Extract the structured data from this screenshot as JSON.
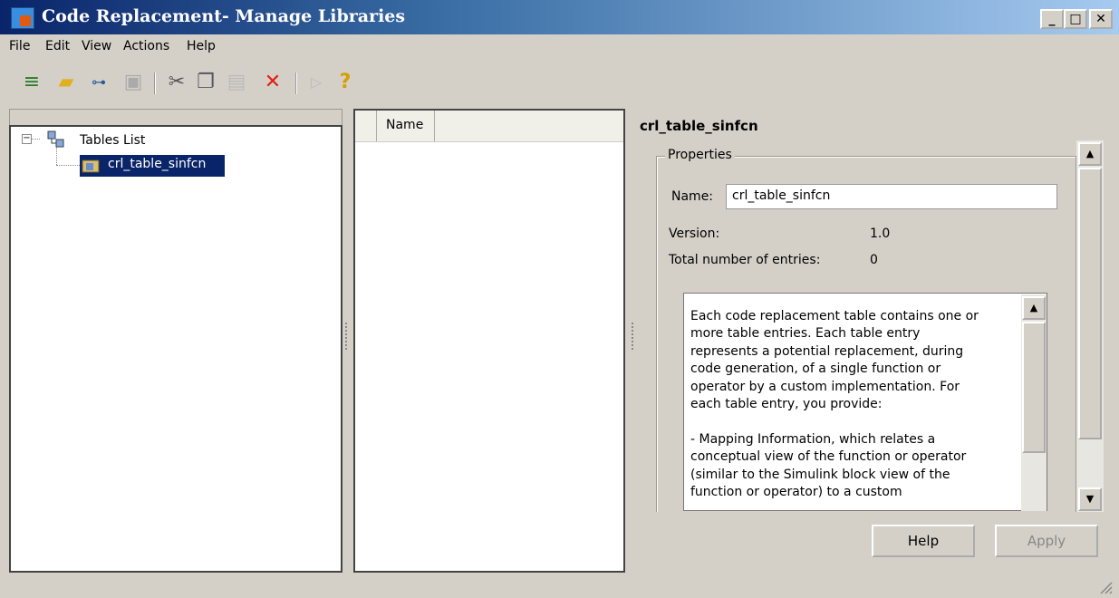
{
  "window": {
    "title": "Code Replacement- Manage Libraries",
    "minimize": "_",
    "maximize": "□",
    "close": "✕"
  },
  "menu": [
    "File",
    "Edit",
    "View",
    "Actions",
    "Help"
  ],
  "toolbar": {
    "icons": [
      "new-table-icon",
      "open-folder-icon",
      "add-entry-icon",
      "save-icon",
      "cut-icon",
      "copy-icon",
      "paste-icon",
      "delete-icon",
      "validate-icon",
      "help-icon"
    ]
  },
  "tree": {
    "root": "Tables List",
    "child": "crl_table_sinfcn"
  },
  "list": {
    "column": "Name"
  },
  "detail": {
    "title": "crl_table_sinfcn",
    "group_label": "Properties",
    "name_label": "Name:",
    "name_value": "crl_table_sinfcn",
    "version_label": "Version:",
    "version_value": "1.0",
    "entries_label": "Total number of entries:",
    "entries_value": "0",
    "description": "Each code replacement table contains one or\nmore table entries. Each table entry\nrepresents a potential replacement, during\ncode generation, of a single function or\noperator by a custom implementation. For\neach table entry, you provide:\n\n- Mapping Information, which relates a\nconceptual view of the function or operator\n(similar to the Simulink block view of the\nfunction or operator) to a custom"
  },
  "buttons": {
    "help": "Help",
    "apply": "Apply"
  },
  "colors": {
    "selection": "#0a246a",
    "titlebar": "#0a246a"
  }
}
